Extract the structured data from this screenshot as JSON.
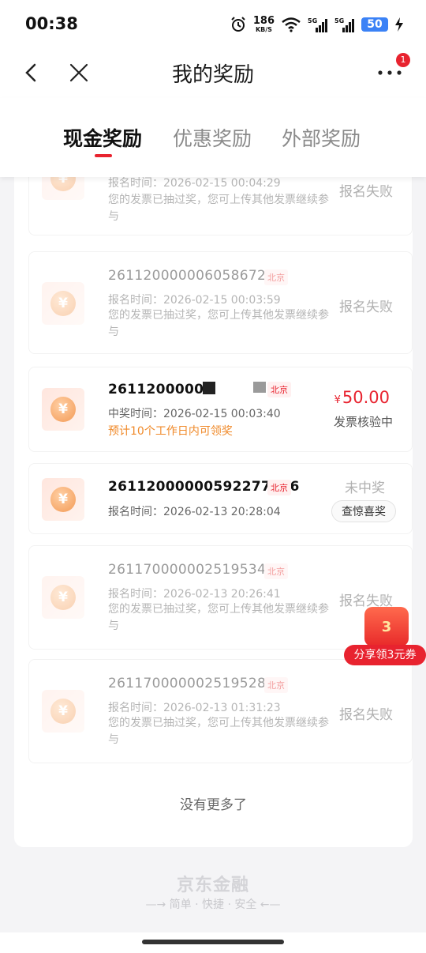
{
  "status_bar": {
    "time": "00:38",
    "speed_value": "186",
    "speed_unit": "KB/S",
    "net1": "5G",
    "net2": "5G",
    "battery": "50"
  },
  "nav": {
    "title": "我的奖励",
    "more_badge": "1"
  },
  "tabs": [
    {
      "label": "现金奖励",
      "active": true
    },
    {
      "label": "优惠奖励",
      "active": false
    },
    {
      "label": "外部奖励",
      "active": false
    }
  ],
  "records": [
    {
      "code": "",
      "city": "",
      "time_line": "报名时间：2026-02-15 00:04:29",
      "note": "您的发票已抽过奖，您可上传其他发票继续参与",
      "status": "报名失败"
    },
    {
      "code": "26112000000605867221",
      "city": "北京",
      "time_line": "报名时间：2026-02-15 00:03:59",
      "note": "您的发票已抽过奖，您可上传其他发票继续参与",
      "status": "报名失败"
    },
    {
      "code": "26112000000",
      "city": "北京",
      "time_line": "中奖时间：2026-02-15 00:03:40",
      "note": "预计10个工作日内可领奖",
      "amount_symbol": "¥",
      "amount": "50.00",
      "status": "发票核验中"
    },
    {
      "code": "26112000000592277836",
      "city": "北京",
      "time_line": "报名时间：2026-02-13 20:28:04",
      "status": "未中奖",
      "action": "查惊喜奖"
    },
    {
      "code": "26117000000251953462",
      "city": "北京",
      "time_line": "报名时间：2026-02-13 20:26:41",
      "note": "您的发票已抽过奖，您可上传其他发票继续参与",
      "status": "报名失败"
    },
    {
      "code": "26117000000251952897",
      "city": "北京",
      "time_line": "报名时间：2026-02-13 01:31:23",
      "note": "您的发票已抽过奖，您可上传其他发票继续参与",
      "status": "报名失败"
    }
  ],
  "coin_symbol": "¥",
  "no_more": "没有更多了",
  "promo": {
    "badge_value": "3",
    "label": "分享领3元券"
  },
  "brand": {
    "name": "京东金融",
    "tagline": "—→ 简单 · 快捷 · 安全 ←—"
  },
  "colors": {
    "accent": "#e8232f",
    "orange": "#f08a2a"
  }
}
